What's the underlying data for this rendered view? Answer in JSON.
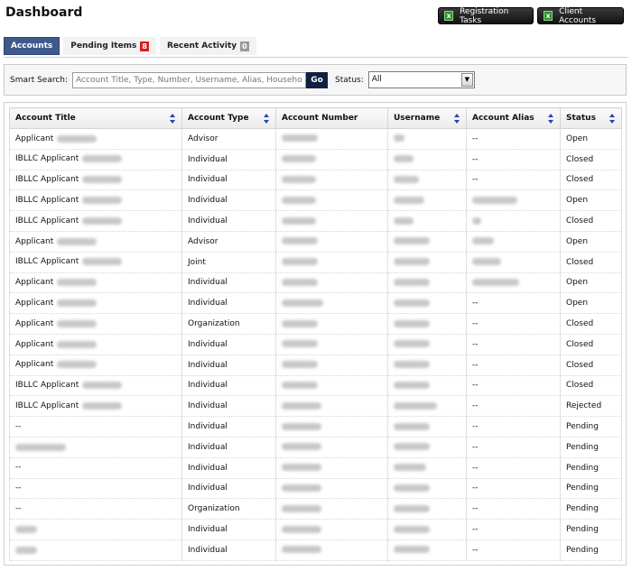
{
  "page": {
    "title": "Dashboard"
  },
  "header_buttons": {
    "registration_tasks": "Registration Tasks",
    "client_accounts": "Client Accounts"
  },
  "tabs": [
    {
      "label": "Accounts",
      "active": true,
      "badge": ""
    },
    {
      "label": "Pending Items",
      "active": false,
      "badge": "8"
    },
    {
      "label": "Recent Activity",
      "active": false,
      "badge": "0"
    }
  ],
  "search": {
    "label": "Smart Search:",
    "placeholder": "Account Title, Type, Number, Username, Alias, Household",
    "go_label": "Go",
    "status_label": "Status:",
    "status_value": "All",
    "select_arrow": "▼"
  },
  "table": {
    "columns": [
      "Account Title",
      "Account Type",
      "Account Number",
      "Username",
      "Account Alias",
      "Status"
    ],
    "rows": [
      {
        "title_prefix": "Applicant",
        "type": "Advisor",
        "alias": "--",
        "status": "Open",
        "title_blur": 44,
        "num_blur": 40,
        "user_blur": 12,
        "alias_blur": 0
      },
      {
        "title_prefix": "IBLLC Applicant",
        "type": "Individual",
        "alias": "--",
        "status": "Closed",
        "title_blur": 44,
        "num_blur": 38,
        "user_blur": 22,
        "alias_blur": 0
      },
      {
        "title_prefix": "IBLLC Applicant",
        "type": "Individual",
        "alias": "--",
        "status": "Closed",
        "title_blur": 44,
        "num_blur": 38,
        "user_blur": 28,
        "alias_blur": 0
      },
      {
        "title_prefix": "IBLLC Applicant",
        "type": "Individual",
        "alias": "",
        "status": "Open",
        "title_blur": 44,
        "num_blur": 38,
        "user_blur": 34,
        "alias_blur": 50
      },
      {
        "title_prefix": "IBLLC Applicant",
        "type": "Individual",
        "alias": "",
        "status": "Closed",
        "title_blur": 44,
        "num_blur": 38,
        "user_blur": 22,
        "alias_blur": 10
      },
      {
        "title_prefix": "Applicant",
        "type": "Advisor",
        "alias": "",
        "status": "Open",
        "title_blur": 44,
        "num_blur": 40,
        "user_blur": 40,
        "alias_blur": 24
      },
      {
        "title_prefix": "IBLLC Applicant",
        "type": "Joint",
        "alias": "",
        "status": "Closed",
        "title_blur": 44,
        "num_blur": 40,
        "user_blur": 40,
        "alias_blur": 32
      },
      {
        "title_prefix": "Applicant",
        "type": "Individual",
        "alias": "",
        "status": "Open",
        "title_blur": 44,
        "num_blur": 40,
        "user_blur": 40,
        "alias_blur": 52
      },
      {
        "title_prefix": "Applicant",
        "type": "Individual",
        "alias": "--",
        "status": "Open",
        "title_blur": 44,
        "num_blur": 46,
        "user_blur": 40,
        "alias_blur": 0
      },
      {
        "title_prefix": "Applicant",
        "type": "Organization",
        "alias": "--",
        "status": "Closed",
        "title_blur": 44,
        "num_blur": 40,
        "user_blur": 40,
        "alias_blur": 0
      },
      {
        "title_prefix": "Applicant",
        "type": "Individual",
        "alias": "--",
        "status": "Closed",
        "title_blur": 44,
        "num_blur": 40,
        "user_blur": 40,
        "alias_blur": 0
      },
      {
        "title_prefix": "Applicant",
        "type": "Individual",
        "alias": "--",
        "status": "Closed",
        "title_blur": 44,
        "num_blur": 40,
        "user_blur": 40,
        "alias_blur": 0
      },
      {
        "title_prefix": "IBLLC Applicant",
        "type": "Individual",
        "alias": "--",
        "status": "Closed",
        "title_blur": 44,
        "num_blur": 40,
        "user_blur": 40,
        "alias_blur": 0
      },
      {
        "title_prefix": "IBLLC Applicant",
        "type": "Individual",
        "alias": "--",
        "status": "Rejected",
        "title_blur": 44,
        "num_blur": 44,
        "user_blur": 48,
        "alias_blur": 0
      },
      {
        "title_prefix": "--",
        "type": "Individual",
        "alias": "--",
        "status": "Pending",
        "title_blur": 0,
        "num_blur": 44,
        "user_blur": 40,
        "alias_blur": 0
      },
      {
        "title_prefix": "",
        "type": "Individual",
        "alias": "--",
        "status": "Pending",
        "title_blur": 56,
        "num_blur": 44,
        "user_blur": 40,
        "alias_blur": 0
      },
      {
        "title_prefix": "--",
        "type": "Individual",
        "alias": "--",
        "status": "Pending",
        "title_blur": 0,
        "num_blur": 44,
        "user_blur": 36,
        "alias_blur": 0
      },
      {
        "title_prefix": "--",
        "type": "Individual",
        "alias": "--",
        "status": "Pending",
        "title_blur": 0,
        "num_blur": 44,
        "user_blur": 40,
        "alias_blur": 0
      },
      {
        "title_prefix": "--",
        "type": "Organization",
        "alias": "--",
        "status": "Pending",
        "title_blur": 0,
        "num_blur": 44,
        "user_blur": 40,
        "alias_blur": 0
      },
      {
        "title_prefix": "",
        "type": "Individual",
        "alias": "--",
        "status": "Pending",
        "title_blur": 24,
        "num_blur": 44,
        "user_blur": 40,
        "alias_blur": 0
      },
      {
        "title_prefix": "",
        "type": "Individual",
        "alias": "--",
        "status": "Pending",
        "title_blur": 24,
        "num_blur": 44,
        "user_blur": 40,
        "alias_blur": 0
      }
    ]
  }
}
